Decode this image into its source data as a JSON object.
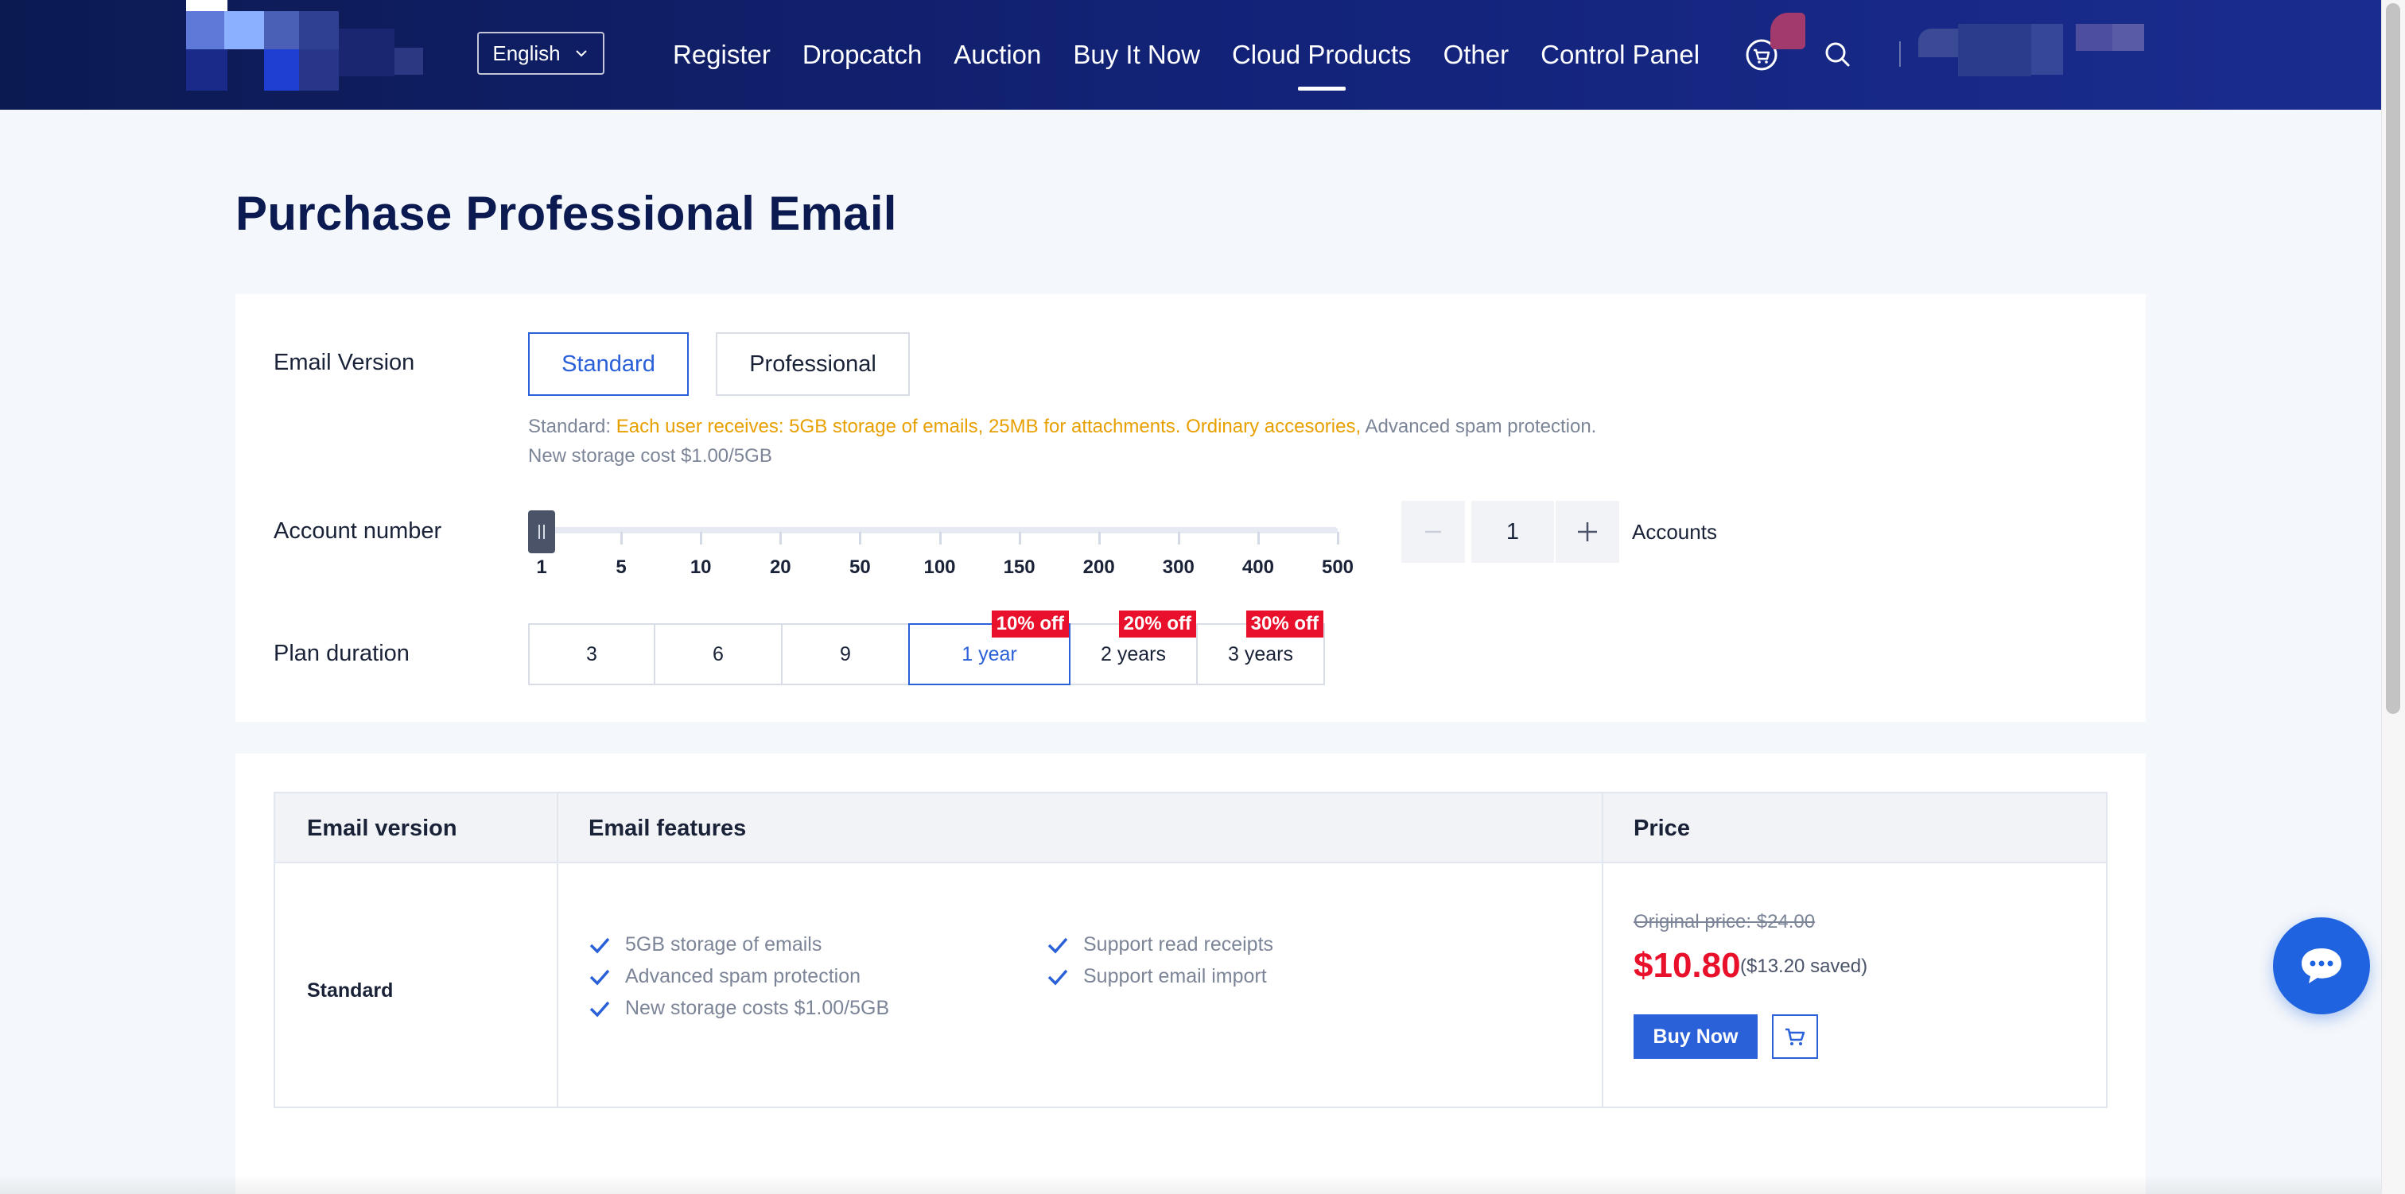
{
  "header": {
    "language": "English",
    "nav": [
      "Register",
      "Dropcatch",
      "Auction",
      "Buy It Now",
      "Cloud Products",
      "Other",
      "Control Panel"
    ],
    "active_nav": "Cloud Products"
  },
  "page": {
    "title": "Purchase Professional Email"
  },
  "email_version": {
    "label": "Email Version",
    "options": [
      "Standard",
      "Professional"
    ],
    "selected": "Standard",
    "desc_prefix": "Standard: ",
    "desc_highlight": "Each user receives: 5GB storage of emails, 25MB for attachments. Ordinary accesories,",
    "desc_suffix": " Advanced spam protection.",
    "desc_line2": "New storage cost $1.00/5GB"
  },
  "account_number": {
    "label": "Account number",
    "ticks": [
      "1",
      "5",
      "10",
      "20",
      "50",
      "100",
      "150",
      "200",
      "300",
      "400",
      "500"
    ],
    "slider_value": 1,
    "stepper_minus": "−",
    "stepper_plus": "+",
    "value": "1",
    "unit": "Accounts"
  },
  "plan_duration": {
    "label": "Plan duration",
    "options": [
      {
        "label": "3",
        "badge": ""
      },
      {
        "label": "6",
        "badge": ""
      },
      {
        "label": "9",
        "badge": ""
      },
      {
        "label": "1 year",
        "badge": "10% off"
      },
      {
        "label": "2 years",
        "badge": "20% off"
      },
      {
        "label": "3 years",
        "badge": "30% off"
      }
    ],
    "selected": "1 year"
  },
  "table": {
    "headers": [
      "Email version",
      "Email features",
      "Price"
    ],
    "version": "Standard",
    "features_left": [
      "5GB storage of emails",
      "Advanced spam protection",
      "New storage costs $1.00/5GB"
    ],
    "features_right": [
      "Support read receipts",
      "Support email import"
    ],
    "original_price": "Original price: $24.00",
    "price": "$10.80",
    "saved": "($13.20 saved)",
    "buy_label": "Buy Now"
  },
  "colors": {
    "accent": "#2a60d8",
    "header_bg": "#13237a",
    "price_red": "#e8102a",
    "highlight_orange": "#e8a000"
  },
  "icons": [
    "chevron-down-icon",
    "cart-icon",
    "search-icon",
    "check-icon",
    "chat-icon"
  ]
}
